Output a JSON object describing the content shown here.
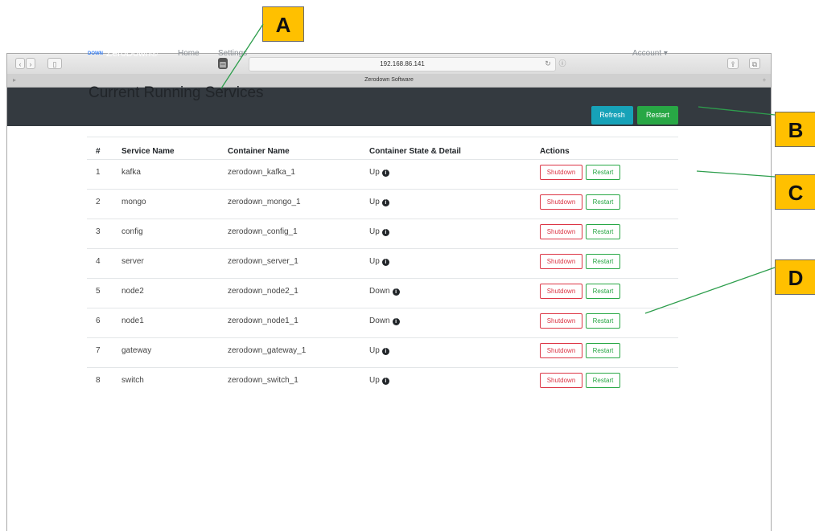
{
  "browser": {
    "address": "192.168.86.141",
    "tab_title": "Zerodown Software"
  },
  "navbar": {
    "logo_text_top": "ZERO",
    "logo_text_bottom": "DOWN",
    "brand": "ZeroDown®",
    "links": [
      "Home",
      "Settings"
    ],
    "account": "Account ▾"
  },
  "main": {
    "title": "Current Running Services",
    "refresh_label": "Refresh",
    "restart_label": "Restart"
  },
  "table": {
    "headers": [
      "#",
      "Service Name",
      "Container Name",
      "Container State & Detail",
      "Actions"
    ],
    "rows": [
      {
        "num": "1",
        "service": "kafka",
        "container": "zerodown_kafka_1",
        "state": "Up"
      },
      {
        "num": "2",
        "service": "mongo",
        "container": "zerodown_mongo_1",
        "state": "Up"
      },
      {
        "num": "3",
        "service": "config",
        "container": "zerodown_config_1",
        "state": "Up"
      },
      {
        "num": "4",
        "service": "server",
        "container": "zerodown_server_1",
        "state": "Up"
      },
      {
        "num": "5",
        "service": "node2",
        "container": "zerodown_node2_1",
        "state": "Down"
      },
      {
        "num": "6",
        "service": "node1",
        "container": "zerodown_node1_1",
        "state": "Down"
      },
      {
        "num": "7",
        "service": "gateway",
        "container": "zerodown_gateway_1",
        "state": "Up"
      },
      {
        "num": "8",
        "service": "switch",
        "container": "zerodown_switch_1",
        "state": "Up"
      }
    ],
    "shutdown_label": "Shutdown",
    "restart_label": "Restart"
  },
  "callouts": [
    "A",
    "B",
    "C",
    "D"
  ],
  "colors": {
    "navbar": "#343a40",
    "refresh": "#17a2b8",
    "restart": "#28a745",
    "shutdown": "#dc3545",
    "callout": "#ffc000",
    "callout_line": "#2e9e4d"
  },
  "icons": [
    "info-icon",
    "share-icon",
    "tabs-icon",
    "reload-icon",
    "back-icon",
    "forward-icon",
    "sidebar-icon"
  ]
}
